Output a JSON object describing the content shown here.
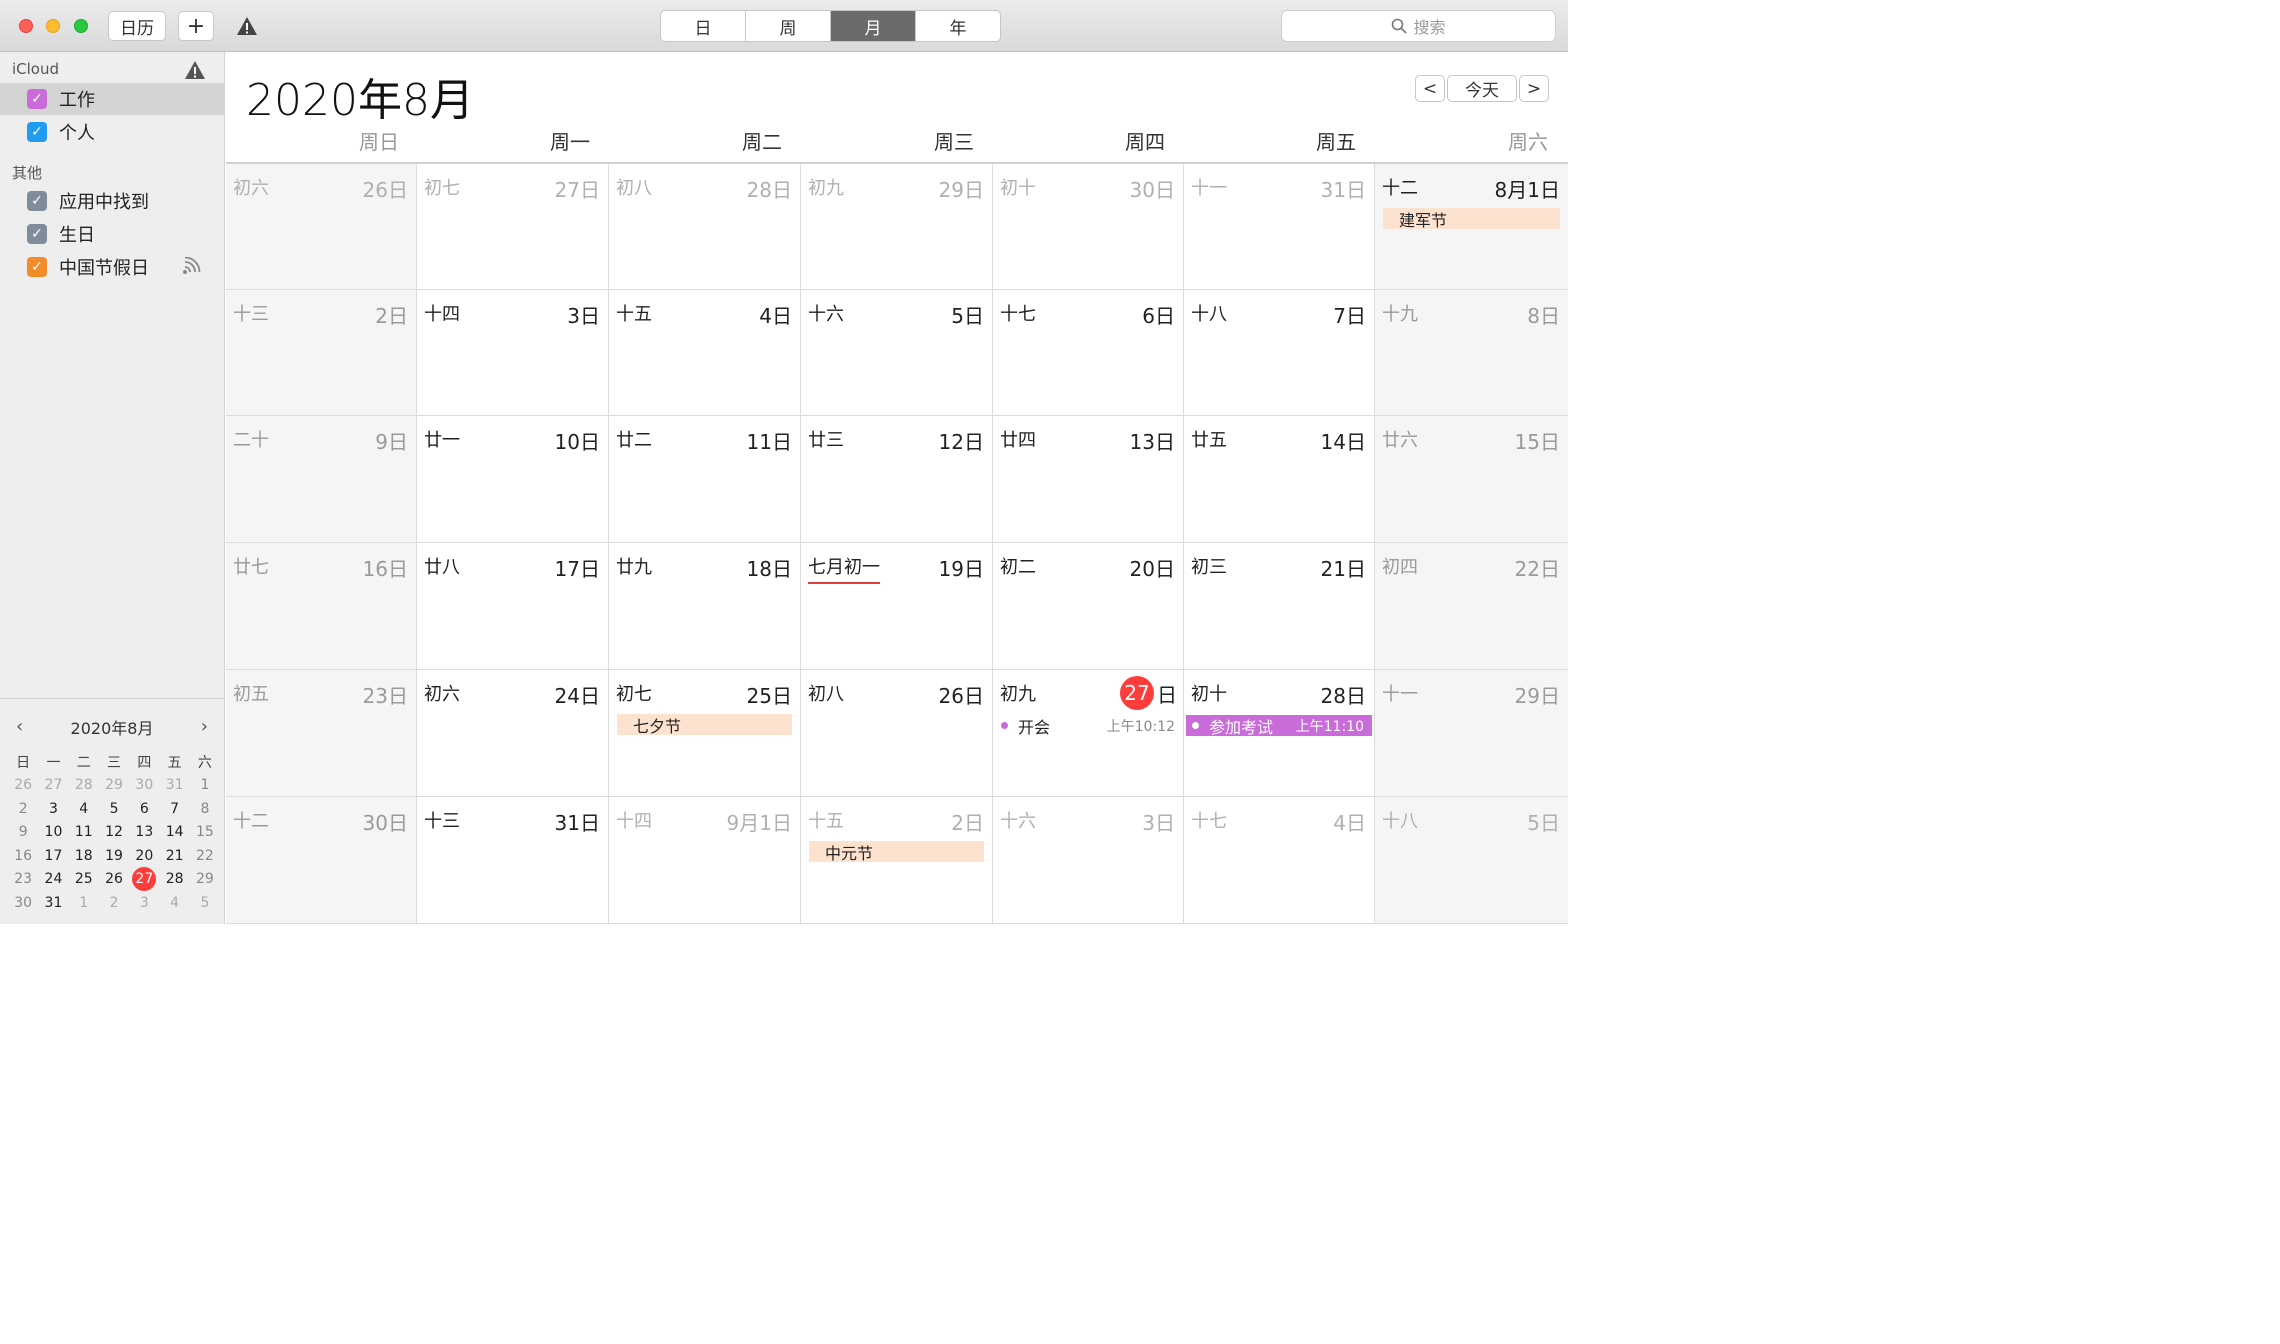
{
  "toolbar": {
    "calendars_label": "日历",
    "add_label": "+",
    "views": [
      "日",
      "周",
      "月",
      "年"
    ],
    "active_view": "月",
    "search_placeholder": "搜索"
  },
  "sidebar": {
    "icloud_label": "iCloud",
    "icloud_items": [
      {
        "label": "工作",
        "color": "#c96bd8",
        "checked": true,
        "selected": true
      },
      {
        "label": "个人",
        "color": "#1f9bf0",
        "checked": true,
        "selected": false
      }
    ],
    "other_label": "其他",
    "other_items": [
      {
        "label": "应用中找到",
        "color": "#7f8c9a",
        "checked": true
      },
      {
        "label": "生日",
        "color": "#7f8c9a",
        "checked": true
      },
      {
        "label": "中国节假日",
        "color": "#f28c28",
        "checked": true,
        "subscribed": true
      }
    ]
  },
  "mini_calendar": {
    "title": "2020年8月",
    "weekdays": [
      "日",
      "一",
      "二",
      "三",
      "四",
      "五",
      "六"
    ],
    "weeks": [
      [
        "26",
        "27",
        "28",
        "29",
        "30",
        "31",
        "1"
      ],
      [
        "2",
        "3",
        "4",
        "5",
        "6",
        "7",
        "8"
      ],
      [
        "9",
        "10",
        "11",
        "12",
        "13",
        "14",
        "15"
      ],
      [
        "16",
        "17",
        "18",
        "19",
        "20",
        "21",
        "22"
      ],
      [
        "23",
        "24",
        "25",
        "26",
        "27",
        "28",
        "29"
      ],
      [
        "30",
        "31",
        "1",
        "2",
        "3",
        "4",
        "5"
      ]
    ],
    "today": "27"
  },
  "main": {
    "title": "2020年8月",
    "nav_prev": "<",
    "today_label": "今天",
    "nav_next": ">",
    "weekdays": [
      "周日",
      "周一",
      "周二",
      "周三",
      "周四",
      "周五",
      "周六"
    ],
    "weeks": [
      [
        {
          "lunar": "初六",
          "day": "26日",
          "other": true
        },
        {
          "lunar": "初七",
          "day": "27日",
          "other": true
        },
        {
          "lunar": "初八",
          "day": "28日",
          "other": true
        },
        {
          "lunar": "初九",
          "day": "29日",
          "other": true
        },
        {
          "lunar": "初十",
          "day": "30日",
          "other": true
        },
        {
          "lunar": "十一",
          "day": "31日",
          "other": true
        },
        {
          "lunar": "十二",
          "day": "8月1日",
          "holiday": "建军节",
          "bright": true
        }
      ],
      [
        {
          "lunar": "十三",
          "day": "2日"
        },
        {
          "lunar": "十四",
          "day": "3日"
        },
        {
          "lunar": "十五",
          "day": "4日"
        },
        {
          "lunar": "十六",
          "day": "5日"
        },
        {
          "lunar": "十七",
          "day": "6日"
        },
        {
          "lunar": "十八",
          "day": "7日"
        },
        {
          "lunar": "十九",
          "day": "8日"
        }
      ],
      [
        {
          "lunar": "二十",
          "day": "9日"
        },
        {
          "lunar": "廿一",
          "day": "10日"
        },
        {
          "lunar": "廿二",
          "day": "11日"
        },
        {
          "lunar": "廿三",
          "day": "12日"
        },
        {
          "lunar": "廿四",
          "day": "13日"
        },
        {
          "lunar": "廿五",
          "day": "14日"
        },
        {
          "lunar": "廿六",
          "day": "15日"
        }
      ],
      [
        {
          "lunar": "廿七",
          "day": "16日"
        },
        {
          "lunar": "廿八",
          "day": "17日"
        },
        {
          "lunar": "廿九",
          "day": "18日"
        },
        {
          "lunar": "七月初一",
          "day": "19日",
          "new_month": true
        },
        {
          "lunar": "初二",
          "day": "20日"
        },
        {
          "lunar": "初三",
          "day": "21日"
        },
        {
          "lunar": "初四",
          "day": "22日"
        }
      ],
      [
        {
          "lunar": "初五",
          "day": "23日"
        },
        {
          "lunar": "初六",
          "day": "24日"
        },
        {
          "lunar": "初七",
          "day": "25日",
          "holiday": "七夕节"
        },
        {
          "lunar": "初八",
          "day": "26日"
        },
        {
          "lunar": "初九",
          "day": "日",
          "today": "27",
          "event": {
            "title": "开会",
            "time": "上午10:12",
            "style": "dot"
          }
        },
        {
          "lunar": "初十",
          "day": "28日",
          "event": {
            "title": "参加考试",
            "time": "上午11:10",
            "style": "filled"
          }
        },
        {
          "lunar": "十一",
          "day": "29日"
        }
      ],
      [
        {
          "lunar": "十二",
          "day": "30日"
        },
        {
          "lunar": "十三",
          "day": "31日"
        },
        {
          "lunar": "十四",
          "day": "9月1日",
          "other": true
        },
        {
          "lunar": "十五",
          "day": "2日",
          "other": true,
          "holiday": "中元节"
        },
        {
          "lunar": "十六",
          "day": "3日",
          "other": true
        },
        {
          "lunar": "十七",
          "day": "4日",
          "other": true
        },
        {
          "lunar": "十八",
          "day": "5日",
          "other": true
        }
      ]
    ]
  }
}
